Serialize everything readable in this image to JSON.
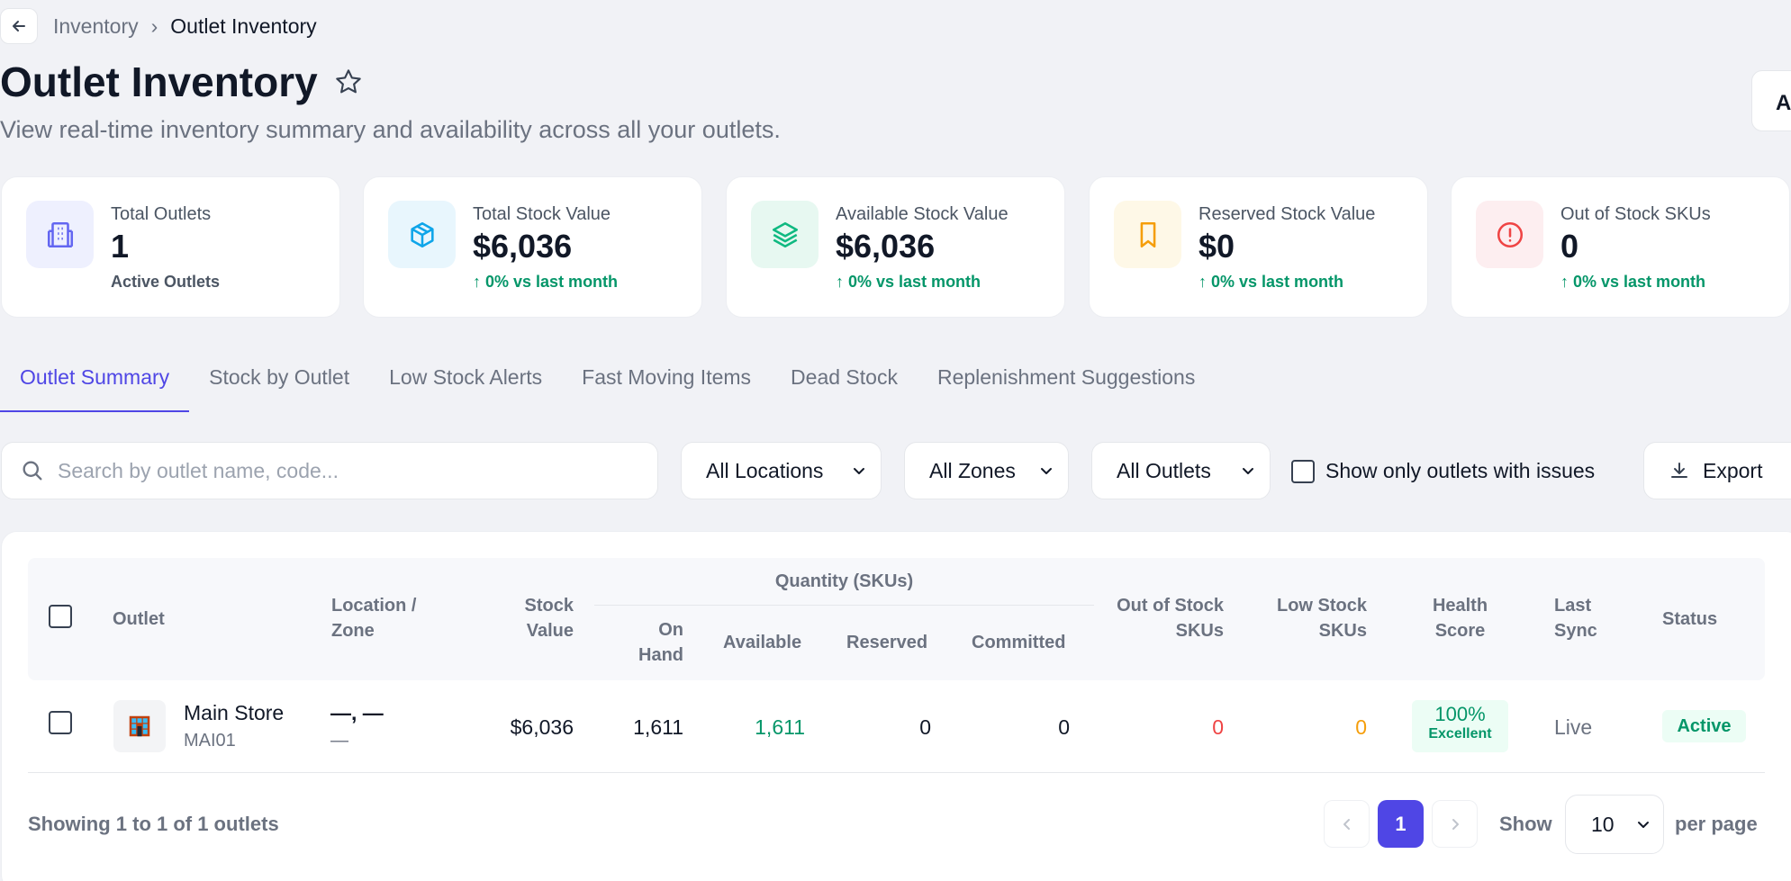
{
  "breadcrumb": {
    "parent": "Inventory",
    "separator": "›",
    "current": "Outlet Inventory"
  },
  "header": {
    "title": "Outlet Inventory",
    "subtitle": "View real-time inventory summary and availability across all your outlets.",
    "right_button_label": "A"
  },
  "cards": [
    {
      "label": "Total Outlets",
      "value": "1",
      "sub": "Active Outlets",
      "icon": "building-icon",
      "color": "#6366f1"
    },
    {
      "label": "Total Stock Value",
      "value": "$6,036",
      "sub": "↑ 0% vs last month",
      "icon": "box-icon",
      "color": "#0ea5e9"
    },
    {
      "label": "Available Stock Value",
      "value": "$6,036",
      "sub": "↑ 0% vs last month",
      "icon": "layers-icon",
      "color": "#10b981"
    },
    {
      "label": "Reserved Stock Value",
      "value": "$0",
      "sub": "↑ 0% vs last month",
      "icon": "bookmark-icon",
      "color": "#f59e0b"
    },
    {
      "label": "Out of Stock SKUs",
      "value": "0",
      "sub": "↑ 0% vs last month",
      "icon": "alert-icon",
      "color": "#ef4444"
    }
  ],
  "tabs": [
    "Outlet Summary",
    "Stock by Outlet",
    "Low Stock Alerts",
    "Fast Moving Items",
    "Dead Stock",
    "Replenishment Suggestions"
  ],
  "filters": {
    "search_placeholder": "Search by outlet name, code...",
    "locations": "All Locations",
    "zones": "All Zones",
    "outlets": "All Outlets",
    "issues_only": "Show only outlets with issues",
    "export": "Export"
  },
  "table": {
    "headers": {
      "outlet": "Outlet",
      "location_1": "Location /",
      "location_2": "Zone",
      "stock_1": "Stock",
      "stock_2": "Value",
      "quantity_group": "Quantity (SKUs)",
      "onhand_1": "On",
      "onhand_2": "Hand",
      "available": "Available",
      "reserved": "Reserved",
      "committed": "Committed",
      "oos_1": "Out of Stock",
      "oos_2": "SKUs",
      "low_1": "Low Stock",
      "low_2": "SKUs",
      "health_1": "Health",
      "health_2": "Score",
      "sync_1": "Last",
      "sync_2": "Sync",
      "status": "Status"
    },
    "rows": [
      {
        "name": "Main Store",
        "code": "MAI01",
        "location": "—, —",
        "zone": "—",
        "stock_value": "$6,036",
        "on_hand": "1,611",
        "available": "1,611",
        "reserved": "0",
        "committed": "0",
        "out_of_stock": "0",
        "low_stock": "0",
        "health_pct": "100%",
        "health_label": "Excellent",
        "last_sync": "Live",
        "status": "Active"
      }
    ]
  },
  "footer": {
    "showing": "Showing 1 to 1 of 1 outlets",
    "current_page": "1",
    "show_label": "Show",
    "per_page_value": "10",
    "per_page_label": "per page"
  }
}
